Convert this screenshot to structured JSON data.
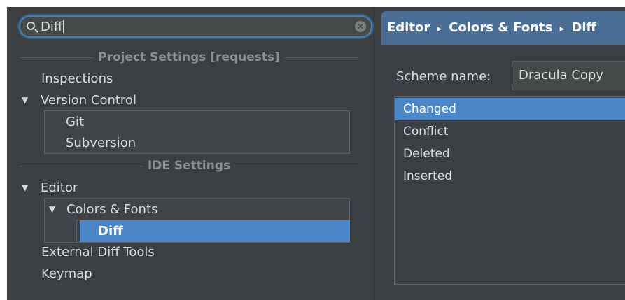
{
  "search": {
    "query": "Diff"
  },
  "tree": {
    "project_header": "Project Settings [requests]",
    "inspections": "Inspections",
    "version_control": "Version Control",
    "git": "Git",
    "subversion": "Subversion",
    "ide_header": "IDE Settings",
    "editor": "Editor",
    "colors_fonts": "Colors & Fonts",
    "diff": "Diff",
    "external_diff_tools": "External Diff Tools",
    "keymap": "Keymap",
    "expanded_glyph": "▼"
  },
  "breadcrumb": {
    "parts": [
      "Editor",
      "Colors & Fonts",
      "Diff"
    ],
    "separator": "▸"
  },
  "scheme": {
    "label": "Scheme name:",
    "value": "Dracula Copy"
  },
  "list": {
    "items": [
      "Changed",
      "Conflict",
      "Deleted",
      "Inserted"
    ],
    "selected": "Changed"
  },
  "colors": {
    "background": "#3c3f41",
    "selection": "#4b87c8",
    "breadcrumb_bg": "#4a6e96",
    "text": "#d9dadb",
    "header_text": "#8b8f91"
  }
}
